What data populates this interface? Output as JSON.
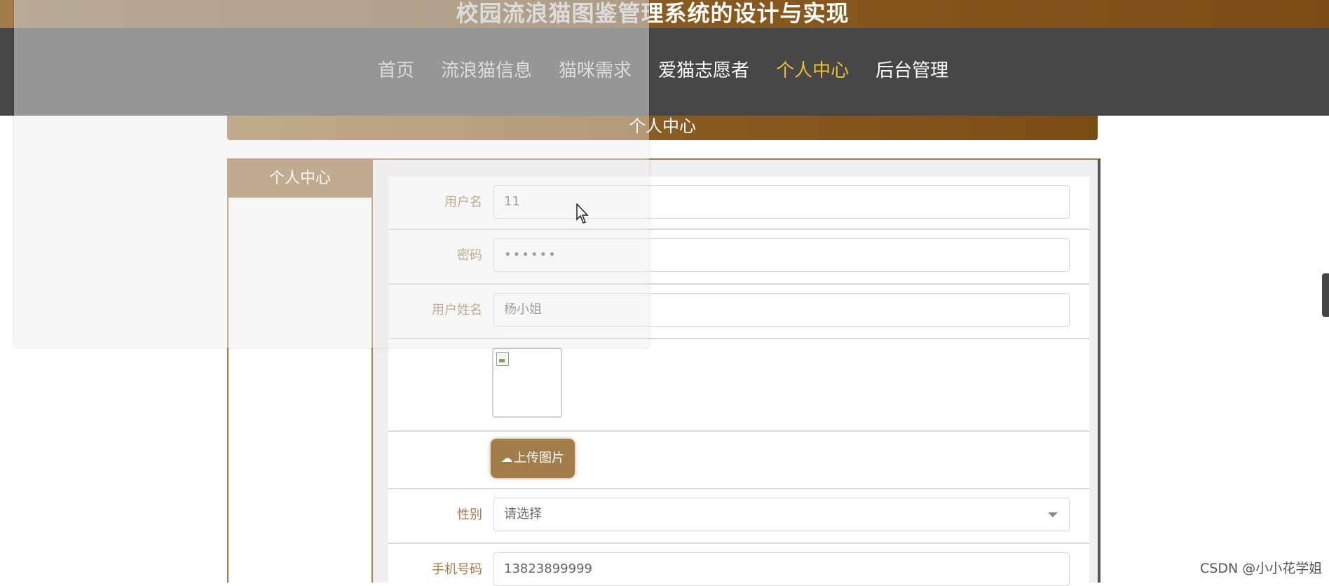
{
  "header": {
    "site_title": "校园流浪猫图鉴管理系统的设计与实现"
  },
  "nav": {
    "items": [
      {
        "label": "首页",
        "active": false
      },
      {
        "label": "流浪猫信息",
        "active": false
      },
      {
        "label": "猫咪需求",
        "active": false
      },
      {
        "label": "爱猫志愿者",
        "active": false
      },
      {
        "label": "个人中心",
        "active": true
      },
      {
        "label": "后台管理",
        "active": false
      }
    ],
    "active_color": "#f0bd3b"
  },
  "section": {
    "title": "个人中心"
  },
  "sidebar": {
    "title": "个人中心"
  },
  "form": {
    "username": {
      "label": "用户名",
      "value": "11"
    },
    "password": {
      "label": "密码",
      "value": "••••••"
    },
    "real_name": {
      "label": "用户姓名",
      "value": "杨小姐"
    },
    "photo": {
      "upload_label": "上传图片",
      "icon": "cloud-upload-icon"
    },
    "gender": {
      "label": "性别",
      "value": "请选择"
    },
    "phone": {
      "label": "手机号码",
      "value": "13823899999"
    }
  },
  "colors": {
    "brand": "#a17d4a",
    "brand_dark": "#7a4d14",
    "nav_bg": "#474747"
  },
  "watermark": "CSDN @小小花学姐"
}
